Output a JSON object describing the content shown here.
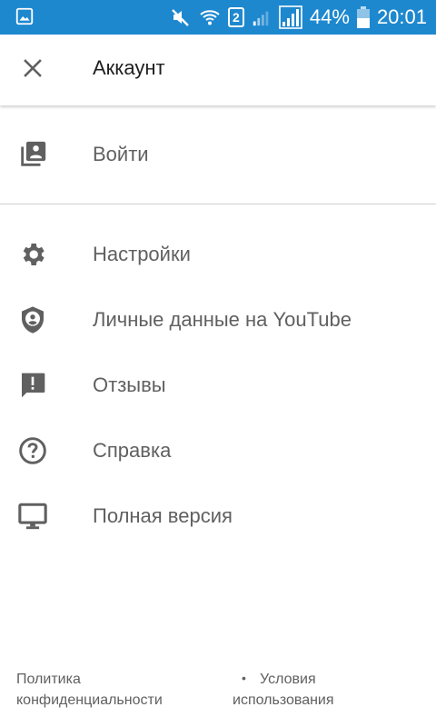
{
  "status_bar": {
    "battery_percent": "44%",
    "time": "20:01",
    "sim_slot": "2",
    "color": "#1e88cf"
  },
  "toolbar": {
    "title": "Аккаунт",
    "close_icon": "close-icon"
  },
  "menu": {
    "sign_in": {
      "label": "Войти",
      "icon": "account-box-icon"
    },
    "items": [
      {
        "label": "Настройки",
        "icon": "gear-icon"
      },
      {
        "label": "Личные данные на YouTube",
        "icon": "privacy-shield-icon"
      },
      {
        "label": "Отзывы",
        "icon": "feedback-icon"
      },
      {
        "label": "Справка",
        "icon": "help-icon"
      },
      {
        "label": "Полная версия",
        "icon": "desktop-icon"
      }
    ]
  },
  "footer": {
    "privacy_line1": "Политика",
    "privacy_line2": "конфиденциальности",
    "separator": "•",
    "terms_line1": "Условия",
    "terms_line2": "использования"
  }
}
